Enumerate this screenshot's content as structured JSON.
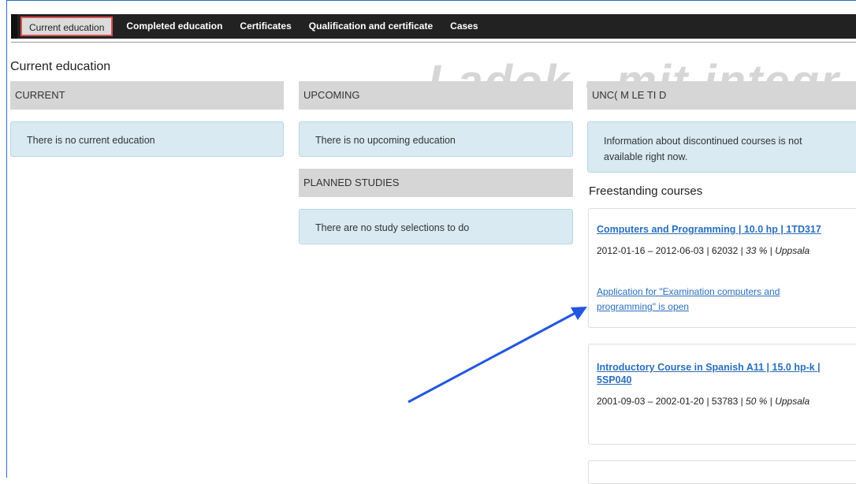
{
  "nav": {
    "tabs": [
      {
        "label": "Current education"
      },
      {
        "label": "Completed education"
      },
      {
        "label": "Certificates"
      },
      {
        "label": "Qualification and certificate"
      },
      {
        "label": "Cases"
      }
    ]
  },
  "page": {
    "title": "Current education",
    "watermark": "Ladok - mit integr"
  },
  "current": {
    "header": "CURRENT",
    "message": "There is no current education"
  },
  "upcoming": {
    "header": "UPCOMING",
    "message": "There is no upcoming education"
  },
  "planned": {
    "header": "PLANNED STUDIES",
    "message": "There are no study selections to do"
  },
  "uncompleted": {
    "header": "UNC( M  LE TI D",
    "message": "Information about discontinued courses is not available right now."
  },
  "freestanding": {
    "title": "Freestanding courses",
    "courses": [
      {
        "title": "Computers and Programming | 10.0 hp | 1TD317",
        "dates": "2012-01-16 – 2012-06-03 | 62032 | ",
        "pace": "33 %",
        "sep": " | ",
        "location": "Uppsala",
        "link": "Application for \"Examination computers and programming\" is open"
      },
      {
        "title": "Introductory Course in Spanish A11 | 15.0 hp-k | 5SP040",
        "dates": "2001-09-03 – 2002-01-20 | 53783 | ",
        "pace": "50 %",
        "sep": " | ",
        "location": "Uppsala"
      }
    ]
  },
  "colors": {
    "navbar": "#222222",
    "active_tab_border": "#d9534f",
    "info_box": "#d9eaf3",
    "link": "#2a6ebb",
    "arrow": "#2456e0"
  }
}
